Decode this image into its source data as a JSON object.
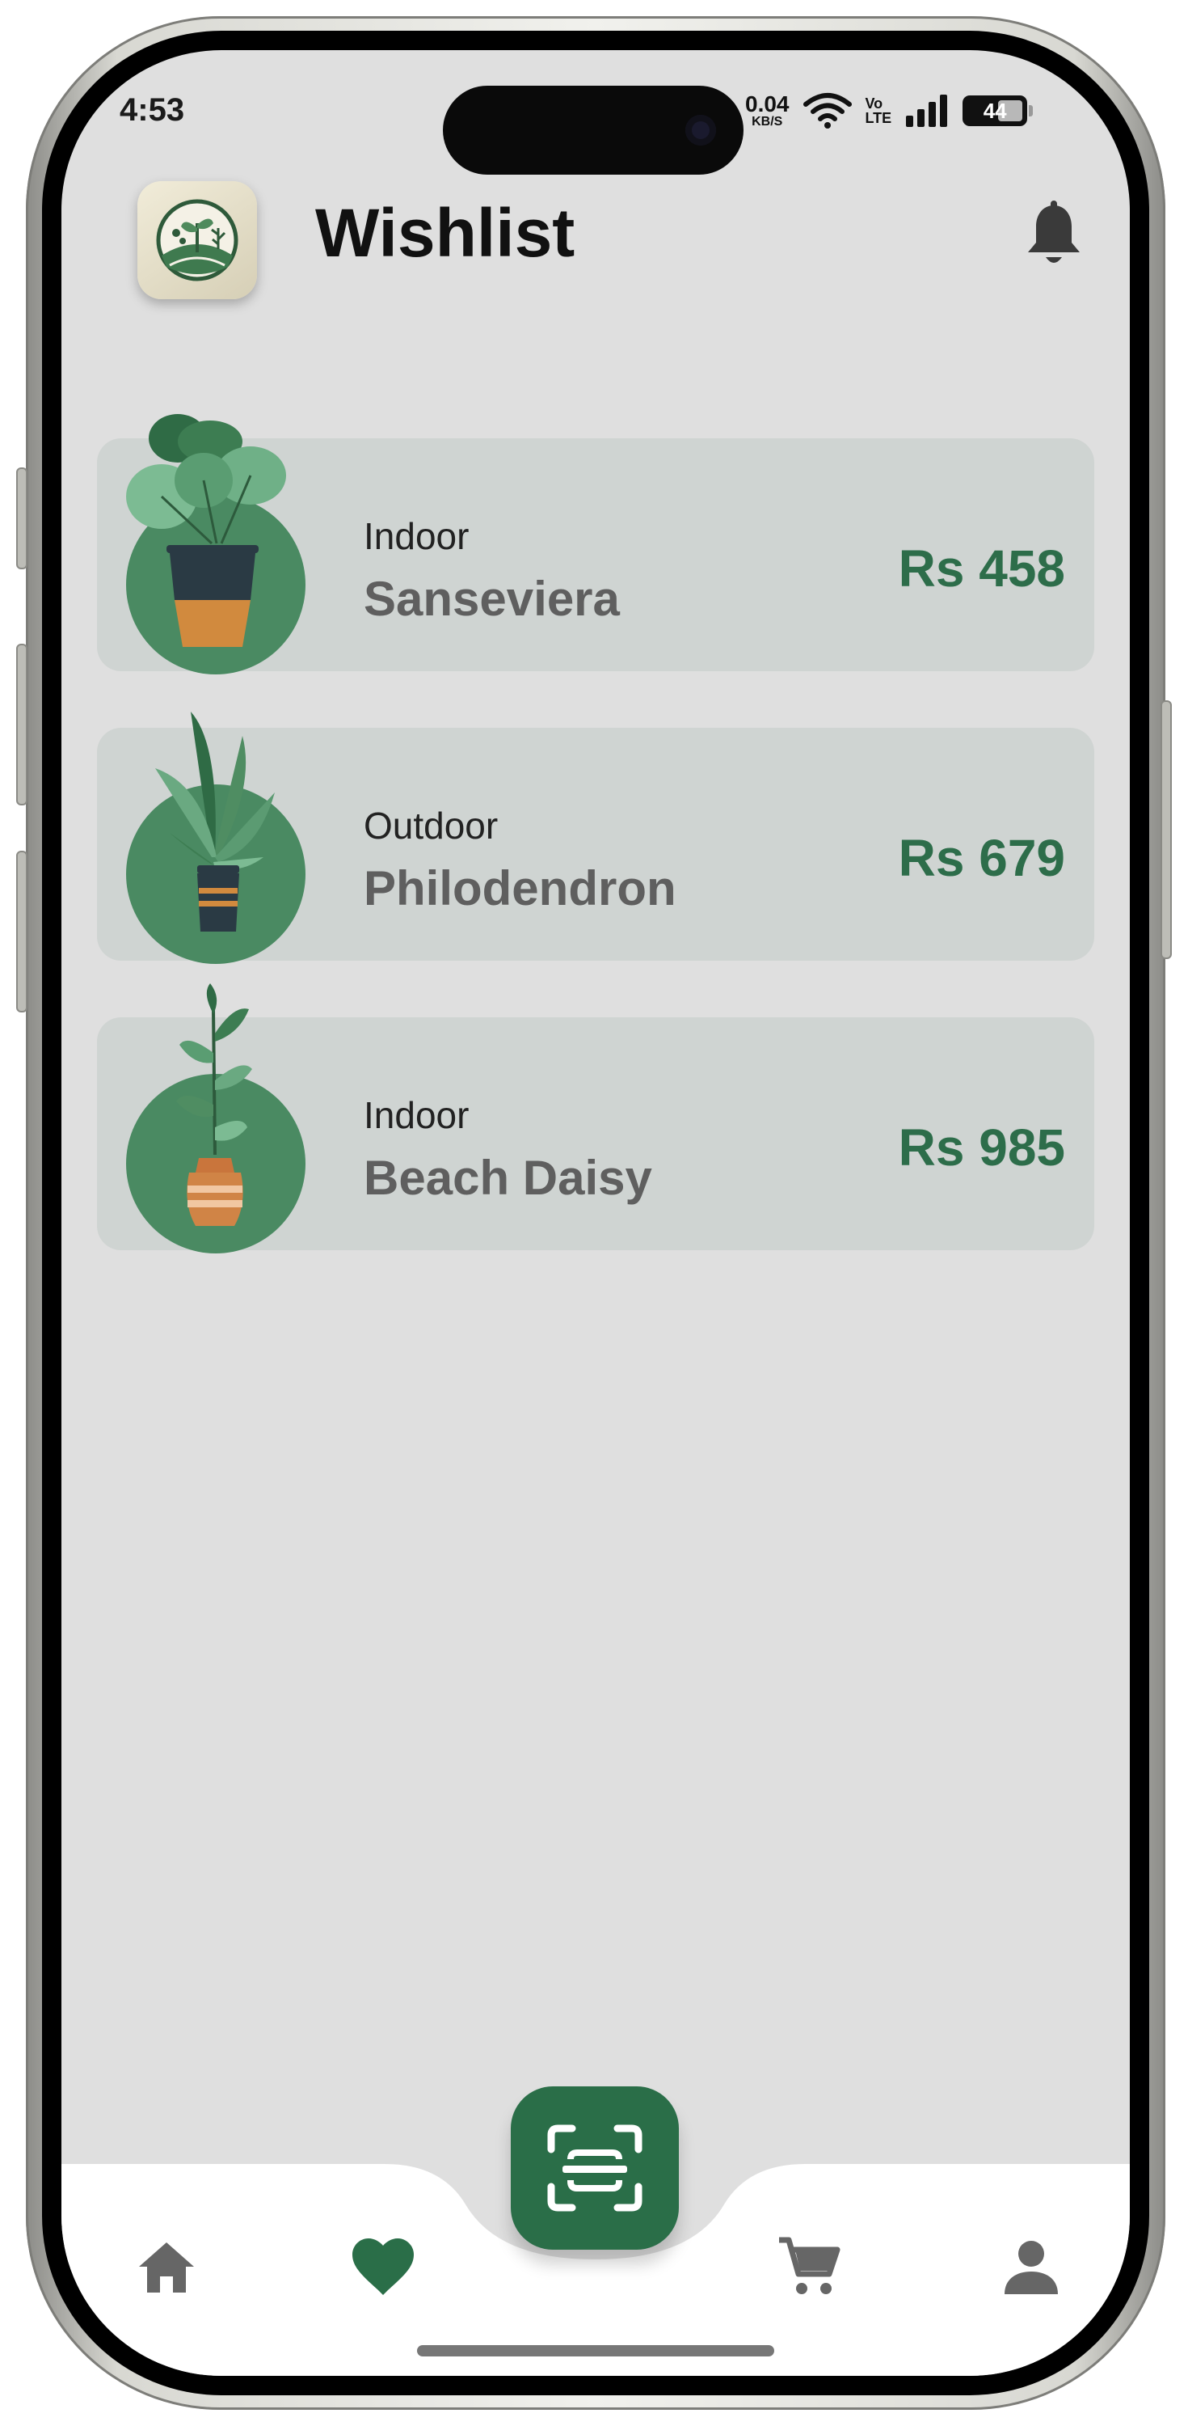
{
  "status_bar": {
    "time": "4:53",
    "net_speed_value": "0.04",
    "net_speed_unit": "KB/S",
    "volte_top": "Vo",
    "volte_bottom": "LTE",
    "battery": "44"
  },
  "header": {
    "title": "Wishlist",
    "logo_icon": "plant-garden-logo-icon",
    "notification_icon": "bell-icon"
  },
  "wishlist": [
    {
      "category": "Indoor",
      "name": "Sanseviera",
      "price": "Rs 458",
      "icon": "leafy-plant-icon"
    },
    {
      "category": "Outdoor",
      "name": "Philodendron",
      "price": "Rs 679",
      "icon": "palm-plant-icon"
    },
    {
      "category": "Indoor",
      "name": "Beach Daisy",
      "price": "Rs 985",
      "icon": "tall-leaf-plant-icon"
    }
  ],
  "bottom_nav": {
    "items": [
      {
        "name": "home",
        "icon": "home-icon",
        "active": false
      },
      {
        "name": "wishlist",
        "icon": "heart-icon",
        "active": true
      },
      {
        "name": "scan",
        "icon": "scan-icon",
        "active": false
      },
      {
        "name": "cart",
        "icon": "cart-icon",
        "active": false
      },
      {
        "name": "profile",
        "icon": "person-icon",
        "active": false
      }
    ]
  },
  "colors": {
    "accent": "#2a6e48",
    "price": "#2d6d4a",
    "card_bg": "#cfd4d2",
    "screen_bg": "#dfdfdf",
    "plant_circle": "#4a8a62",
    "inactive_icon": "#666666"
  }
}
